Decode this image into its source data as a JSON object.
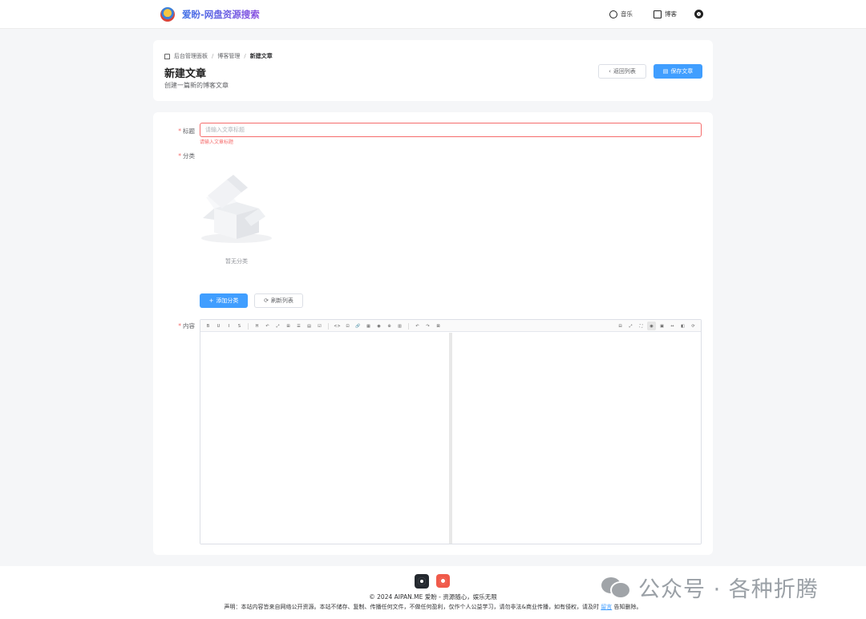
{
  "header": {
    "brand": "爱盼-网盘资源搜索",
    "nav": [
      {
        "label": "音乐",
        "icon": "music-icon"
      },
      {
        "label": "博客",
        "icon": "blog-icon"
      }
    ],
    "settings_icon": "gear-icon"
  },
  "page": {
    "breadcrumb": [
      "后台管理面板",
      "博客管理",
      "新建文章"
    ],
    "title": "新建文章",
    "subtitle": "创建一篇新的博客文章",
    "back_label": "返回列表",
    "save_label": "保存文章"
  },
  "form": {
    "title_label": "标题",
    "title_placeholder": "请输入文章标题",
    "title_value": "",
    "title_error": "请输入文章标题",
    "category_label": "分类",
    "category_empty": "暂无分类",
    "add_category_label": "添加分类",
    "refresh_label": "刷新列表",
    "content_label": "内容",
    "required_mark": "*"
  },
  "editor": {
    "toolbar_left": [
      "B",
      "U",
      "I",
      "S",
      "H",
      "↶",
      "⤢",
      "⊞",
      "☰",
      "▤",
      "☑",
      "<>",
      "⊡",
      "🔗",
      "▦",
      "◉",
      "⊕",
      "▥",
      "↶",
      "↷",
      "⊠"
    ],
    "toolbar_right": [
      "⊟",
      "⤢",
      "⛶",
      "◉",
      "▣",
      "↔",
      "◧",
      "⟳"
    ]
  },
  "footer": {
    "copyright": "© 2024 AIPAN.ME 爱盼 - 资源随心，娱乐无限",
    "disclaimer_prefix": "声明：本站内容皆来自网络公开资源。本站不储存、复制、传播任何文件，不做任何盈利，仅作个人公益学习，请勿非法&商业传播，如有侵权，请及时",
    "disclaimer_link": "留言",
    "disclaimer_suffix": "告知删除。",
    "icons": [
      "github-icon",
      "rss-icon"
    ]
  },
  "watermark": {
    "text": "公众号 · 各种折腾"
  }
}
